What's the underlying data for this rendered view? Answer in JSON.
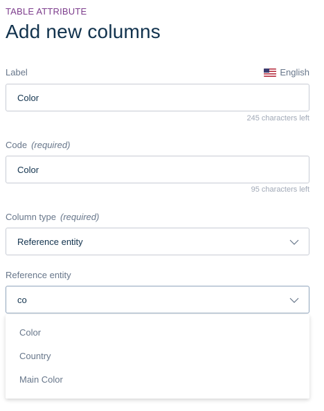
{
  "header": {
    "eyebrow": "TABLE ATTRIBUTE",
    "title": "Add new columns"
  },
  "label_field": {
    "label": "Label",
    "locale": "English",
    "locale_flag": "us-flag-icon",
    "value": "Color",
    "helper": "245 characters left"
  },
  "code_field": {
    "label": "Code",
    "required": "(required)",
    "value": "Color",
    "helper": "95 characters left"
  },
  "column_type_field": {
    "label": "Column type",
    "required": "(required)",
    "value": "Reference entity",
    "icon": "chevron-down-icon"
  },
  "reference_entity_field": {
    "label": "Reference entity",
    "value": "co",
    "icon": "chevron-down-icon",
    "options": [
      {
        "label": "Color"
      },
      {
        "label": "Country"
      },
      {
        "label": "Main Color"
      }
    ]
  },
  "colors": {
    "accent": "#7c3c8c",
    "title": "#11324d",
    "label": "#67768a",
    "border": "#c7cbd4",
    "helper": "#a1a9b7"
  }
}
